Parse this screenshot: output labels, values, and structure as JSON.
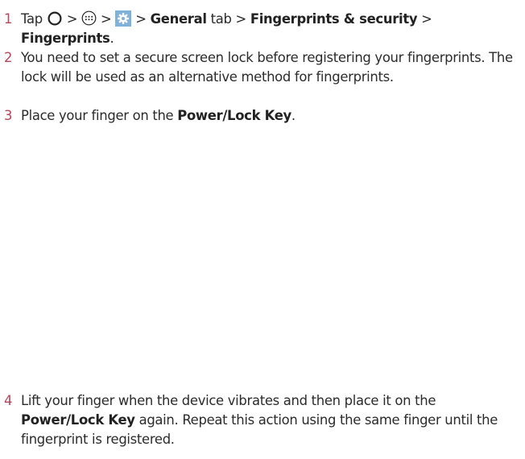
{
  "steps": [
    {
      "number": "1",
      "tap": "Tap",
      "sep": ">",
      "general": "General",
      "tab": "tab",
      "fingerprints_security": "Fingerprints & security",
      "fingerprints": "Fingerprints",
      "period": "."
    },
    {
      "number": "2",
      "text": "You need to set a secure screen lock before registering your fingerprints. The lock will be used as an alternative method for fingerprints."
    },
    {
      "number": "3",
      "pre": "Place your finger on the",
      "key": "Power/Lock Key",
      "post": "."
    },
    {
      "number": "4",
      "pre": "Lift your finger when the device vibrates and then place it on the",
      "key": "Power/Lock Key",
      "post": "again. Repeat this action using the same finger until the fingerprint is registered."
    }
  ],
  "icons": {
    "home": "home-circle-icon",
    "apps": "apps-grid-icon",
    "settings": "settings-gear-icon"
  },
  "colors": {
    "step_number": "#b4475c",
    "text": "#2b2b2b",
    "settings_bg": "#7fb1d9"
  }
}
